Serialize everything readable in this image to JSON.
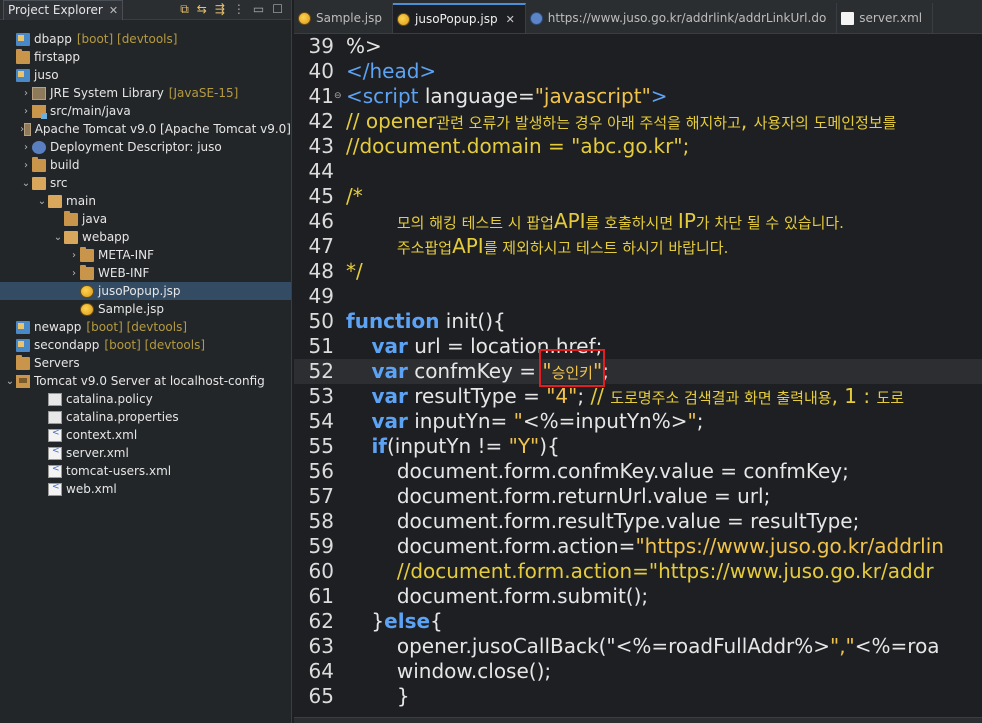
{
  "explorer": {
    "tab_label": "Project Explorer",
    "tab_close": "✕",
    "tree": [
      {
        "label": "dbapp",
        "decoration": "[boot] [devtools]",
        "icon": "project-icon",
        "depth": 0,
        "arrow": "",
        "kind": "proj"
      },
      {
        "label": "firstapp",
        "decoration": "",
        "icon": "folder-icon",
        "depth": 0,
        "arrow": "",
        "kind": "folder"
      },
      {
        "label": "juso",
        "decoration": "",
        "icon": "project-icon",
        "depth": 0,
        "arrow": "",
        "kind": "proj"
      },
      {
        "label": "JRE System Library",
        "decoration": "[JavaSE-15]",
        "icon": "library-icon",
        "depth": 1,
        "arrow": "›",
        "kind": "lib"
      },
      {
        "label": "src/main/java",
        "decoration": "",
        "icon": "source-folder-icon",
        "depth": 1,
        "arrow": "›",
        "kind": "srcf"
      },
      {
        "label": "Apache Tomcat v9.0 [Apache Tomcat v9.0]",
        "decoration": "",
        "icon": "library-icon",
        "depth": 1,
        "arrow": "›",
        "kind": "lib"
      },
      {
        "label": "Deployment Descriptor: juso",
        "decoration": "",
        "icon": "descriptor-icon",
        "depth": 1,
        "arrow": "›",
        "kind": "dd"
      },
      {
        "label": "build",
        "decoration": "",
        "icon": "folder-icon",
        "depth": 1,
        "arrow": "›",
        "kind": "folder"
      },
      {
        "label": "src",
        "decoration": "",
        "icon": "folder-open-icon",
        "depth": 1,
        "arrow": "⌄",
        "kind": "openfolder"
      },
      {
        "label": "main",
        "decoration": "",
        "icon": "folder-open-icon",
        "depth": 2,
        "arrow": "⌄",
        "kind": "openfolder"
      },
      {
        "label": "java",
        "decoration": "",
        "icon": "folder-icon",
        "depth": 3,
        "arrow": "",
        "kind": "folder"
      },
      {
        "label": "webapp",
        "decoration": "",
        "icon": "folder-open-icon",
        "depth": 3,
        "arrow": "⌄",
        "kind": "openfolder"
      },
      {
        "label": "META-INF",
        "decoration": "",
        "icon": "folder-icon",
        "depth": 4,
        "arrow": "›",
        "kind": "folder"
      },
      {
        "label": "WEB-INF",
        "decoration": "",
        "icon": "folder-icon",
        "depth": 4,
        "arrow": "›",
        "kind": "folder"
      },
      {
        "label": "jusoPopup.jsp",
        "decoration": "",
        "icon": "jsp-file-icon",
        "depth": 4,
        "arrow": "",
        "kind": "globe",
        "selected": true
      },
      {
        "label": "Sample.jsp",
        "decoration": "",
        "icon": "jsp-file-icon",
        "depth": 4,
        "arrow": "",
        "kind": "globe"
      },
      {
        "label": "newapp",
        "decoration": "[boot] [devtools]",
        "icon": "project-icon",
        "depth": 0,
        "arrow": "",
        "kind": "proj"
      },
      {
        "label": "secondapp",
        "decoration": "[boot] [devtools]",
        "icon": "project-icon",
        "depth": 0,
        "arrow": "",
        "kind": "proj"
      },
      {
        "label": "Servers",
        "decoration": "",
        "icon": "folder-icon",
        "depth": 0,
        "arrow": "",
        "kind": "folder"
      },
      {
        "label": "Tomcat v9.0 Server at localhost-config",
        "decoration": "",
        "icon": "folder-open-icon",
        "depth": 0,
        "arrow": "⌄",
        "kind": "server"
      },
      {
        "label": "catalina.policy",
        "decoration": "",
        "icon": "file-icon",
        "depth": 2,
        "arrow": "",
        "kind": "file"
      },
      {
        "label": "catalina.properties",
        "decoration": "",
        "icon": "file-icon",
        "depth": 2,
        "arrow": "",
        "kind": "file"
      },
      {
        "label": "context.xml",
        "decoration": "",
        "icon": "xml-file-icon",
        "depth": 2,
        "arrow": "",
        "kind": "xml"
      },
      {
        "label": "server.xml",
        "decoration": "",
        "icon": "xml-file-icon",
        "depth": 2,
        "arrow": "",
        "kind": "xml"
      },
      {
        "label": "tomcat-users.xml",
        "decoration": "",
        "icon": "xml-file-icon",
        "depth": 2,
        "arrow": "",
        "kind": "xml"
      },
      {
        "label": "web.xml",
        "decoration": "",
        "icon": "xml-file-icon",
        "depth": 2,
        "arrow": "",
        "kind": "xml"
      }
    ]
  },
  "editor": {
    "tabs": [
      {
        "label": "Sample.jsp",
        "icon": "jsp",
        "active": false,
        "close": ""
      },
      {
        "label": "jusoPopup.jsp",
        "icon": "jsp",
        "active": true,
        "close": "✕"
      },
      {
        "label": "https://www.juso.go.kr/addrlink/addrLinkUrl.do",
        "icon": "web",
        "active": false,
        "close": ""
      },
      {
        "label": "server.xml",
        "icon": "xml",
        "active": false,
        "close": ""
      }
    ],
    "highlighted_value": "\"승인키\"",
    "current_line": 52,
    "lines": [
      {
        "n": "39",
        "html": "%&gt;"
      },
      {
        "n": "40",
        "html": "<span class='tag'>&lt;/head&gt;</span>"
      },
      {
        "n": "41",
        "html": "<span class='tag'>&lt;script</span> <span class='attr'>language=</span><span class='str'>\"javascript\"</span><span class='tag'>&gt;</span>",
        "fold": true
      },
      {
        "n": "42",
        "html": "<span class='cmt'>// opener<span class='ko'>관련 오류가 발생하는 경우 아래 주석을 해지하고</span>, <span class='ko'>사용자의 도메인정보를</span></span>"
      },
      {
        "n": "43",
        "html": "<span class='cmt'>//document.domain = \"abc.go.kr\";</span>"
      },
      {
        "n": "44",
        "html": ""
      },
      {
        "n": "45",
        "html": "<span class='cmt'>/*</span>"
      },
      {
        "n": "46",
        "html": "<span class='cmt'>        <span class='ko'>모의 해킹 테스트 시 팝업</span>API<span class='ko'>를 호출하시면 </span>IP<span class='ko'>가 차단 될 수 있습니다.</span></span>"
      },
      {
        "n": "47",
        "html": "<span class='cmt'>        <span class='ko'>주소팝업</span>API<span class='ko'>를 제외하시고 테스트 하시기 바랍니다.</span></span>"
      },
      {
        "n": "48",
        "html": "<span class='cmt'>*/</span>"
      },
      {
        "n": "49",
        "html": ""
      },
      {
        "n": "50",
        "html": "<span class='kw'>function</span> init(){"
      },
      {
        "n": "51",
        "html": "    <span class='kw'>var</span> url = location.href;"
      },
      {
        "n": "52",
        "html": "    <span class='kw'>var</span> confmKey = <span class='str'>\"<span class='ko'>승인키</span>\"</span>;"
      },
      {
        "n": "53",
        "html": "    <span class='kw'>var</span> resultType = <span class='str'>\"4\"</span>; <span class='cmt'>// <span class='ko'>도로명주소 검색결과 화면 출력내용</span>, 1 : <span class='ko'>도로</span></span>"
      },
      {
        "n": "54",
        "html": "    <span class='kw'>var</span> inputYn= <span class='str'>\"</span>&lt;%=inputYn%&gt;<span class='str'>\"</span>;"
      },
      {
        "n": "55",
        "html": "    <span class='kw'>if</span>(inputYn != <span class='str'>\"Y\"</span>){"
      },
      {
        "n": "56",
        "html": "        document.form.confmKey.value = confmKey;"
      },
      {
        "n": "57",
        "html": "        document.form.returnUrl.value = url;"
      },
      {
        "n": "58",
        "html": "        document.form.resultType.value = resultType;"
      },
      {
        "n": "59",
        "html": "        document.form.action=<span class='str'>\"https://www.juso.go.kr/addrlin</span>"
      },
      {
        "n": "60",
        "html": "        <span class='cmt'>//document.form.action=\"https://www.juso.go.kr/addr</span>"
      },
      {
        "n": "61",
        "html": "        document.form.submit();"
      },
      {
        "n": "62",
        "html": "    }<span class='kw'>else</span>{"
      },
      {
        "n": "63",
        "html": "        opener.jusoCallBack(\"&lt;%=roadFullAddr%&gt;<span class='str'>\",\"</span>&lt;%=roa"
      },
      {
        "n": "64",
        "html": "        window.close();"
      },
      {
        "n": "65",
        "html": "        }"
      }
    ]
  }
}
